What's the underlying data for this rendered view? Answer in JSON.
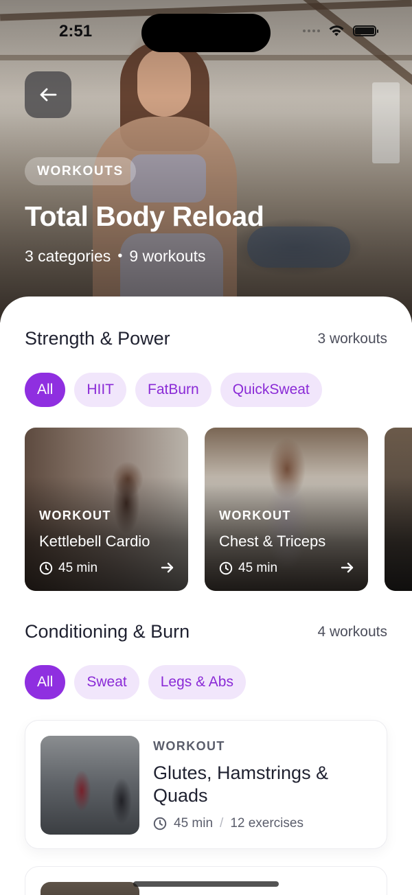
{
  "status_bar": {
    "time": "2:51"
  },
  "hero": {
    "tag": "WORKOUTS",
    "title": "Total Body Reload",
    "categories": "3 categories",
    "separator": "•",
    "workouts": "9 workouts"
  },
  "sections": [
    {
      "title": "Strength & Power",
      "count": "3 workouts",
      "chips": [
        "All",
        "HIIT",
        "FatBurn",
        "QuickSweat"
      ],
      "active_chip": "All",
      "cards": [
        {
          "label": "WORKOUT",
          "title": "Kettlebell Cardio",
          "duration": "45 min"
        },
        {
          "label": "WORKOUT",
          "title": "Chest & Triceps",
          "duration": "45 min"
        }
      ]
    },
    {
      "title": "Conditioning & Burn",
      "count": "4 workouts",
      "chips": [
        "All",
        "Sweat",
        "Legs & Abs"
      ],
      "active_chip": "All",
      "list": [
        {
          "label": "WORKOUT",
          "title": "Glutes, Hamstrings & Quads",
          "duration": "45 min",
          "separator": "/",
          "exercises": "12 exercises"
        }
      ]
    }
  ],
  "colors": {
    "accent": "#8f2fe0",
    "chip_bg": "#f1e6fb",
    "chip_text": "#8a2ad6"
  },
  "icons": [
    "back-arrow-icon",
    "wifi-icon",
    "battery-icon",
    "clock-icon",
    "arrow-right-icon"
  ]
}
